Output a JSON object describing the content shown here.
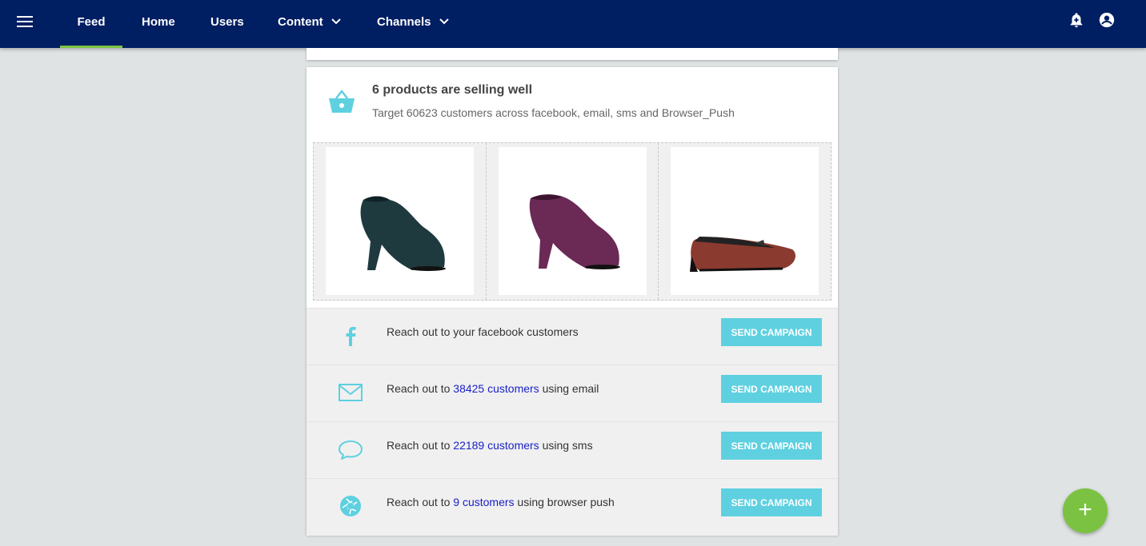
{
  "nav": {
    "items": [
      {
        "label": "Feed",
        "active": true
      },
      {
        "label": "Home"
      },
      {
        "label": "Users"
      },
      {
        "label": "Content",
        "dropdown": true
      },
      {
        "label": "Channels",
        "dropdown": true
      }
    ],
    "icons": [
      "menu-icon",
      "notification-add-icon",
      "account-circle-icon"
    ]
  },
  "card": {
    "icon": "basket-icon",
    "title": "6 products are selling well",
    "subtitle": "Target 60623 customers across facebook, email, sms and Browser_Push",
    "products": [
      {
        "name": "dark teal ankle boot",
        "color": "#1f3a3f"
      },
      {
        "name": "purple ankle boot",
        "color": "#6a2a55"
      },
      {
        "name": "red patterned ballet flat",
        "color": "#8a3a2f"
      }
    ],
    "channels": [
      {
        "icon": "facebook-icon",
        "prefix": "Reach out to your facebook customers",
        "link": "",
        "suffix": "",
        "button": "SEND CAMPAIGN"
      },
      {
        "icon": "email-icon",
        "prefix": "Reach out to ",
        "link": "38425 customers",
        "suffix": " using email",
        "button": "SEND CAMPAIGN"
      },
      {
        "icon": "sms-icon",
        "prefix": "Reach out to ",
        "link": "22189 customers",
        "suffix": " using sms",
        "button": "SEND CAMPAIGN"
      },
      {
        "icon": "browser-push-icon",
        "prefix": "Reach out to ",
        "link": "9 customers",
        "suffix": " using browser push",
        "button": "SEND CAMPAIGN"
      }
    ]
  },
  "fab": {
    "label": "+",
    "icon": "add-icon"
  },
  "colors": {
    "nav_bg": "#001e62",
    "accent_green": "#7bc242",
    "cyan": "#5ed0e0",
    "link": "#1a22c7"
  }
}
